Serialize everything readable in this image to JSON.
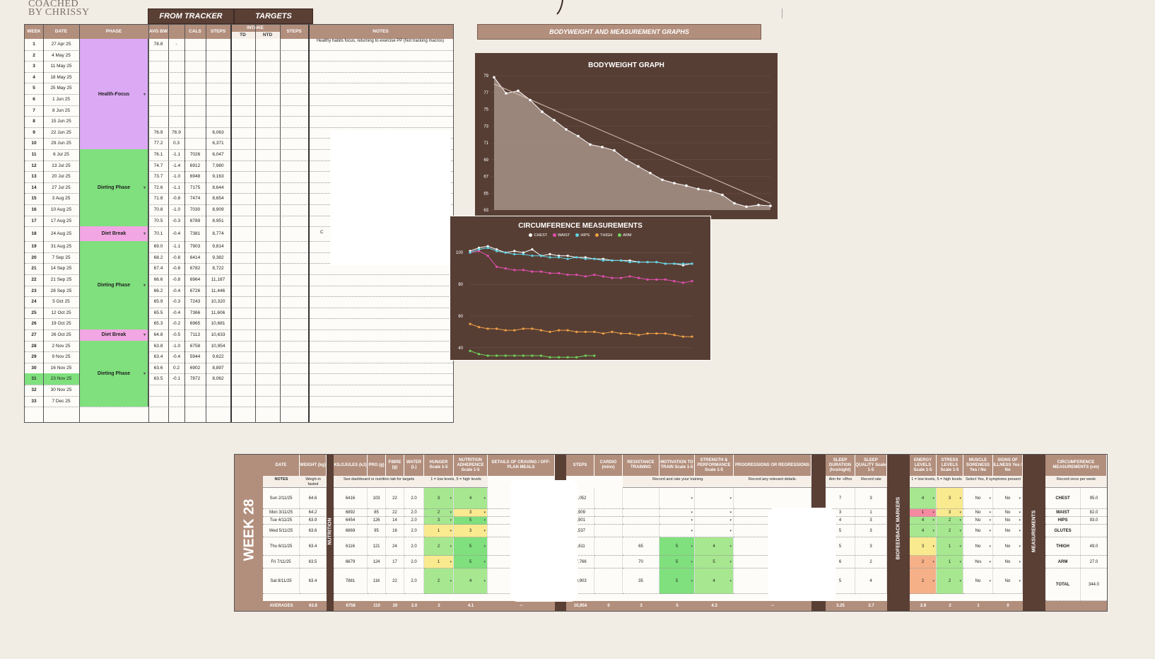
{
  "logo": {
    "line1": "COACHED",
    "line2": "BY CHRISSY"
  },
  "top_headers": {
    "from_tracker": "FROM TRACKER",
    "targets": "TARGETS",
    "graphs": "BODYWEIGHT AND MEASUREMENT GRAPHS"
  },
  "columns": {
    "week": "WEEK",
    "date": "DATE",
    "phase": "PHASE",
    "avg_bw": "AVG BW",
    "cals": "CALS",
    "steps": "STEPS",
    "intake": "INTAKE",
    "td": "TD",
    "ntd": "NTD",
    "t_steps": "STEPS",
    "notes": "NOTES"
  },
  "weeks": [
    {
      "w": "1",
      "d": "27 Apr 25",
      "bw": "78.8",
      "ch": "-",
      "cal": "",
      "st": ""
    },
    {
      "w": "2",
      "d": "4 May 25",
      "bw": "",
      "ch": "",
      "cal": "",
      "st": ""
    },
    {
      "w": "3",
      "d": "11 May 25",
      "bw": "",
      "ch": "",
      "cal": "",
      "st": ""
    },
    {
      "w": "4",
      "d": "18 May 25",
      "bw": "",
      "ch": "",
      "cal": "",
      "st": ""
    },
    {
      "w": "5",
      "d": "25 May 25",
      "bw": "",
      "ch": "",
      "cal": "",
      "st": ""
    },
    {
      "w": "6",
      "d": "1 Jun 25",
      "bw": "",
      "ch": "",
      "cal": "",
      "st": ""
    },
    {
      "w": "7",
      "d": "8 Jun 25",
      "bw": "",
      "ch": "",
      "cal": "",
      "st": ""
    },
    {
      "w": "8",
      "d": "15 Jun 25",
      "bw": "",
      "ch": "",
      "cal": "",
      "st": ""
    },
    {
      "w": "9",
      "d": "22 Jun 25",
      "bw": "76.9",
      "ch": "76.9",
      "cal": "",
      "st": "6,063"
    },
    {
      "w": "10",
      "d": "29 Jun 25",
      "bw": "77.2",
      "ch": "0.3",
      "cal": "",
      "st": "6,371"
    },
    {
      "w": "11",
      "d": "6 Jul 25",
      "bw": "76.1",
      "ch": "-1.1",
      "cal": "7026",
      "st": "6,047"
    },
    {
      "w": "12",
      "d": "13 Jul 25",
      "bw": "74.7",
      "ch": "-1.4",
      "cal": "6912",
      "st": "7,980"
    },
    {
      "w": "13",
      "d": "20 Jul 25",
      "bw": "73.7",
      "ch": "-1.0",
      "cal": "6948",
      "st": "9,163"
    },
    {
      "w": "14",
      "d": "27 Jul 25",
      "bw": "72.6",
      "ch": "-1.1",
      "cal": "7175",
      "st": "8,644"
    },
    {
      "w": "15",
      "d": "3 Aug 25",
      "bw": "71.8",
      "ch": "-0.8",
      "cal": "7474",
      "st": "8,654"
    },
    {
      "w": "16",
      "d": "10 Aug 25",
      "bw": "70.8",
      "ch": "-1.0",
      "cal": "7030",
      "st": "8,909"
    },
    {
      "w": "17",
      "d": "17 Aug 25",
      "bw": "70.5",
      "ch": "-0.3",
      "cal": "6789",
      "st": "8,951"
    },
    {
      "w": "18",
      "d": "24 Aug 25",
      "bw": "70.1",
      "ch": "-0.4",
      "cal": "7381",
      "st": "8,774"
    },
    {
      "w": "19",
      "d": "31 Aug 25",
      "bw": "69.0",
      "ch": "-1.1",
      "cal": "7903",
      "st": "9,814"
    },
    {
      "w": "20",
      "d": "7 Sep 25",
      "bw": "68.2",
      "ch": "-0.8",
      "cal": "6414",
      "st": "9,382"
    },
    {
      "w": "21",
      "d": "14 Sep 25",
      "bw": "67.4",
      "ch": "-0.8",
      "cal": "6782",
      "st": "8,722"
    },
    {
      "w": "22",
      "d": "21 Sep 25",
      "bw": "66.6",
      "ch": "-0.8",
      "cal": "6964",
      "st": "11,187"
    },
    {
      "w": "23",
      "d": "28 Sep 25",
      "bw": "66.2",
      "ch": "-0.4",
      "cal": "6726",
      "st": "11,446"
    },
    {
      "w": "24",
      "d": "5 Oct 25",
      "bw": "65.9",
      "ch": "-0.3",
      "cal": "7243",
      "st": "10,320"
    },
    {
      "w": "25",
      "d": "12 Oct 25",
      "bw": "65.5",
      "ch": "-0.4",
      "cal": "7366",
      "st": "11,606"
    },
    {
      "w": "26",
      "d": "19 Oct 25",
      "bw": "65.3",
      "ch": "-0.2",
      "cal": "6965",
      "st": "10,681"
    },
    {
      "w": "27",
      "d": "26 Oct 25",
      "bw": "64.8",
      "ch": "-0.5",
      "cal": "7113",
      "st": "10,633"
    },
    {
      "w": "28",
      "d": "2 Nov 25",
      "bw": "63.8",
      "ch": "-1.0",
      "cal": "6758",
      "st": "10,954"
    },
    {
      "w": "29",
      "d": "9 Nov 25",
      "bw": "63.4",
      "ch": "-0.4",
      "cal": "5944",
      "st": "9,622"
    },
    {
      "w": "30",
      "d": "16 Nov 25",
      "bw": "63.6",
      "ch": "0.2",
      "cal": "6902",
      "st": "8,897"
    },
    {
      "w": "31",
      "d": "23 Nov 25",
      "bw": "63.5",
      "ch": "-0.1",
      "cal": "7872",
      "st": "8,062"
    },
    {
      "w": "32",
      "d": "30 Nov 25",
      "bw": "",
      "ch": "",
      "cal": "",
      "st": ""
    },
    {
      "w": "33",
      "d": "7 Dec 25",
      "bw": "",
      "ch": "",
      "cal": "",
      "st": ""
    }
  ],
  "phases": [
    {
      "label": "Health-Focus",
      "color": "#dca9f5"
    },
    {
      "label": "Dieting Phase",
      "color": "#7fe07d"
    },
    {
      "label": "Diet Break",
      "color": "#f2a6e3"
    },
    {
      "label": "Dieting Phase",
      "color": "#7fe07d"
    },
    {
      "label": "Diet Break",
      "color": "#f2a6e3"
    },
    {
      "label": "Dieting Phase",
      "color": "#7fe07d"
    }
  ],
  "first_note": "Healthy habits focus, returning to exercise PP (Not tracking macros)",
  "note_c": "C",
  "chart_data": [
    {
      "type": "line",
      "title": "BODYWEIGHT GRAPH",
      "y_ticks": [
        "79",
        "77",
        "75",
        "73",
        "71",
        "69",
        "67",
        "65",
        "63"
      ],
      "ylim": [
        63,
        79
      ],
      "values": [
        78.8,
        76.9,
        77.2,
        76.1,
        74.7,
        73.7,
        72.6,
        71.8,
        70.8,
        70.5,
        70.1,
        69.0,
        68.2,
        67.4,
        66.6,
        66.2,
        65.9,
        65.5,
        65.3,
        64.8,
        63.8,
        63.4,
        63.6,
        63.5
      ],
      "trendline": [
        78.0,
        63.8
      ]
    },
    {
      "type": "line",
      "title": "CIRCUMFERENCE MEASUREMENTS",
      "y_ticks": [
        "100",
        "80",
        "60",
        "40"
      ],
      "ylim": [
        35,
        105
      ],
      "legend": [
        "CHEST",
        "WAIST",
        "HIPS",
        "THIGH",
        "ARM"
      ],
      "series": [
        {
          "name": "CHEST",
          "color": "#ffffff",
          "values": [
            101,
            103,
            104,
            102,
            100,
            101,
            100,
            102,
            98,
            99,
            98,
            98,
            97,
            97,
            96,
            96,
            95,
            95,
            95,
            94,
            94,
            94,
            93,
            93,
            92,
            93
          ]
        },
        {
          "name": "WAIST",
          "color": "#e14fb0",
          "values": [
            100,
            101,
            98,
            91,
            90,
            89,
            89,
            88,
            88,
            87,
            87,
            86,
            86,
            85,
            86,
            85,
            84,
            84,
            85,
            84,
            83,
            83,
            83,
            82,
            81,
            82
          ]
        },
        {
          "name": "HIPS",
          "color": "#5ed5e6",
          "values": [
            100,
            102,
            103,
            101,
            100,
            99,
            99,
            98,
            98,
            97,
            97,
            96,
            97,
            96,
            96,
            95,
            95,
            95,
            94,
            94,
            94,
            94,
            93,
            93,
            93,
            93
          ]
        },
        {
          "name": "THIGH",
          "color": "#f0a046",
          "values": [
            55,
            53,
            52,
            52,
            51,
            51,
            52,
            52,
            51,
            50,
            51,
            51,
            50,
            50,
            50,
            49,
            50,
            49,
            49,
            48,
            49,
            49,
            49,
            48,
            47,
            47
          ]
        },
        {
          "name": "ARM",
          "color": "#6fd35a",
          "values": [
            38,
            36,
            35,
            35,
            35,
            35,
            35,
            35,
            35,
            34,
            34,
            34,
            34,
            35,
            35
          ]
        }
      ]
    }
  ],
  "checkin": {
    "week_label": "WEEK 28",
    "sections": {
      "nutrition": "NUTRITION",
      "activity": "ACTIVITY",
      "sleep": "SLEEP",
      "bio": "BIOFEEDBACK MARKERS",
      "meas": "MEASUREMENTS"
    },
    "headers": [
      "DATE",
      "WEIGHT (kg)",
      "KILOJULES (kJ)",
      "PRO (g)",
      "FIBRE (g)",
      "WATER (L)",
      "HUNGER Scale 1-5",
      "NUTRITION ADHERENCE Scale 1-5",
      "DETAILS OF CRAVING / OFF-PLAN MEALS",
      "STEPS",
      "CARDIO (mins)",
      "RESISTANCE TRAINING",
      "MOTIVATION TO TRAIN Scale 1-5",
      "STRENGTH & PERFORMANCE Scale 1-5",
      "PROGRESSIONS OR REGRESSIONS",
      "SLEEP DURATION (hrs/night)",
      "SLEEP QUALITY Scale 1-5",
      "ENERGY LEVELS Scale 1-5",
      "STRESS LEVELS Scale 1-5",
      "MUSCLE SORENESS Yes / No",
      "SIGNS OF ILLNESS Yes / No",
      "CIRCUMFERENCE MEASUREMENTS (cm)"
    ],
    "notes_row": {
      "label": "NOTES",
      "weight": "Weigh-in fasted",
      "nutrition": "See dashboard or nutrition tab for targets",
      "scale": "1 = low levels, 5 = high levels",
      "training": "Record and rate your training.",
      "progress": "Record any relevant details.",
      "sleep1": "Aim for +8hrs",
      "sleep2": "Record rate",
      "bio": "1 = low levels, 5 = high levels",
      "ill": "Select Yes, if symptoms present",
      "meas": "Record once per week"
    },
    "days": [
      {
        "date": "Sun 2/11/25",
        "wt": "64.6",
        "kj": "6416",
        "pro": "103",
        "fib": "22",
        "wat": "2.0",
        "hun": "3",
        "adh": "4",
        "steps": "11,052",
        "cardio": "",
        "rt": "",
        "mot": "",
        "str": "",
        "sd": "7",
        "sq": "3",
        "en": "4",
        "stx": "3",
        "ms": "No",
        "ill": "No"
      },
      {
        "date": "Mon 3/11/25",
        "wt": "64.2",
        "kj": "6892",
        "pro": "85",
        "fib": "22",
        "wat": "2.0",
        "hun": "2",
        "adh": "3",
        "steps": "8,909",
        "cardio": "",
        "rt": "",
        "mot": "",
        "str": "",
        "sd": "3",
        "sq": "1",
        "en": "1",
        "stx": "3",
        "ms": "No",
        "ill": "No"
      },
      {
        "date": "Tue 4/11/25",
        "wt": "63.9",
        "kj": "6454",
        "pro": "126",
        "fib": "14",
        "wat": "2.0",
        "hun": "3",
        "adh": "5",
        "steps": "8,901",
        "cardio": "",
        "rt": "",
        "mot": "",
        "str": "",
        "sd": "4",
        "sq": "3",
        "en": "4",
        "stx": "2",
        "ms": "No",
        "ill": "No"
      },
      {
        "date": "Wed 5/11/25",
        "wt": "63.6",
        "kj": "6869",
        "pro": "95",
        "fib": "16",
        "wat": "2.0",
        "hun": "1",
        "adh": "3",
        "steps": "9,537",
        "cardio": "",
        "rt": "",
        "mot": "",
        "str": "",
        "sd": "5",
        "sq": "3",
        "en": "4",
        "stx": "2",
        "ms": "No",
        "ill": "No"
      },
      {
        "date": "Thu 6/11/25",
        "wt": "63.4",
        "kj": "6116",
        "pro": "121",
        "fib": "24",
        "wat": "2.0",
        "hun": "2",
        "adh": "5",
        "steps": "9,611",
        "cardio": "",
        "rt": "65",
        "mot": "5",
        "str": "4",
        "sd": "5",
        "sq": "3",
        "en": "3",
        "stx": "1",
        "ms": "No",
        "ill": "No"
      },
      {
        "date": "Fri 7/11/25",
        "wt": "63.5",
        "kj": "6679",
        "pro": "124",
        "fib": "17",
        "wat": "2.0",
        "hun": "1",
        "adh": "5",
        "steps": "17,766",
        "cardio": "",
        "rt": "70",
        "mot": "5",
        "str": "5",
        "sd": "6",
        "sq": "2",
        "en": "2",
        "stx": "1",
        "ms": "Yes",
        "ill": "No"
      },
      {
        "date": "Sat 8/11/25",
        "wt": "63.4",
        "kj": "7881",
        "pro": "116",
        "fib": "22",
        "wat": "2.0",
        "hun": "2",
        "adh": "4",
        "steps": "10,903",
        "cardio": "",
        "rt": "35",
        "mot": "5",
        "str": "4",
        "sd": "5",
        "sq": "4",
        "en": "2",
        "stx": "2",
        "ms": "No",
        "ill": "No"
      }
    ],
    "averages": {
      "label": "AVERAGES",
      "wt": "63.8",
      "kj": "6758",
      "pro": "110",
      "fib": "20",
      "wat": "2.0",
      "hun": "2",
      "adh": "4.1",
      "crav": "--",
      "steps": "10,954",
      "cardio": "0",
      "rt": "3",
      "mot": "5",
      "str": "4.3",
      "prog": "--",
      "sd": "3.25",
      "sq": "2.7",
      "en": "2.9",
      "stx": "2",
      "ms": "1",
      "ill": "0"
    },
    "measurements": [
      {
        "label": "CHEST",
        "val": "95.0"
      },
      {
        "label": "WAIST",
        "val": "82.0"
      },
      {
        "label": "HIPS",
        "val": "93.0"
      },
      {
        "label": "GLUTES",
        "val": ""
      },
      {
        "label": "THIGH",
        "val": "49.0"
      },
      {
        "label": "ARM",
        "val": "27.0"
      },
      {
        "label": "TOTAL",
        "val": "344.0"
      }
    ]
  }
}
